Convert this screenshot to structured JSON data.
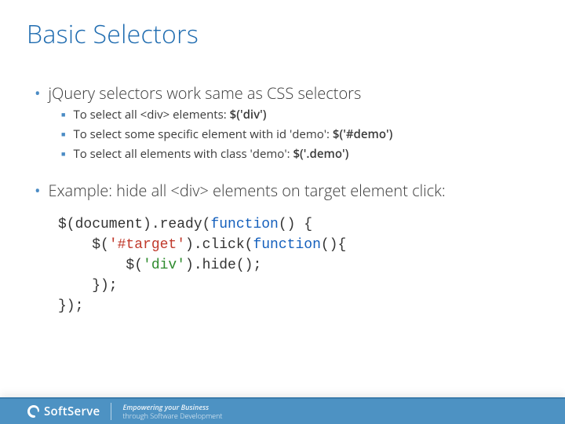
{
  "title": "Basic Selectors",
  "bullets": [
    {
      "text": "jQuery selectors work same as CSS selectors",
      "subs": [
        {
          "pre": "To select all <div> elements: ",
          "bold": "$('div')"
        },
        {
          "pre": "To select some specific element with id 'demo': ",
          "bold": "$('#demo')"
        },
        {
          "pre": "To select all elements with class 'demo': ",
          "bold": "$('.demo')"
        }
      ]
    },
    {
      "text": "Example: hide all <div> elements on target element click:",
      "subs": []
    }
  ],
  "code": {
    "l1a": "$(document).ready(",
    "l1b": "function",
    "l1c": "() {",
    "l2a": "    $(",
    "l2b": "'#target'",
    "l2c": ").click(",
    "l2d": "function",
    "l2e": "(){",
    "l3a": "        $(",
    "l3b": "'div'",
    "l3c": ").hide();",
    "l4": "    });",
    "l5": "});"
  },
  "footer": {
    "brand": "SoftServe",
    "tagline1": "Empowering your Business",
    "tagline2": "through Software Development"
  }
}
